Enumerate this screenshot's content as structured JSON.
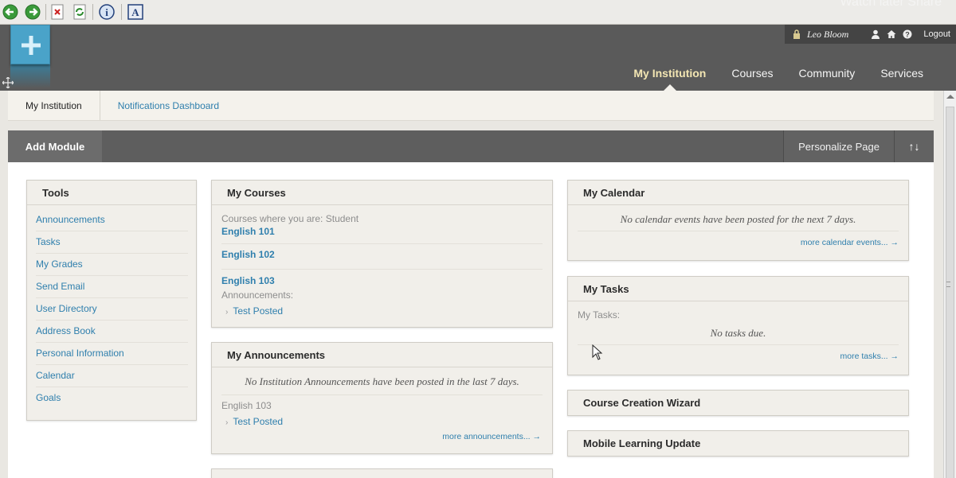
{
  "browser": {
    "overlay_text": "Watch later   Share",
    "buttons": [
      "back-icon",
      "forward-icon",
      "stop-icon",
      "refresh-icon",
      "info-icon",
      "text-icon"
    ]
  },
  "header": {
    "user_name": "Leo Bloom",
    "logout": "Logout",
    "nav": [
      "My Institution",
      "Courses",
      "Community",
      "Services"
    ]
  },
  "subtabs": [
    "My Institution",
    "Notifications Dashboard"
  ],
  "module_bar": {
    "add_module": "Add Module",
    "personalize": "Personalize Page",
    "sort_symbol": "↑↓"
  },
  "tools": {
    "title": "Tools",
    "items": [
      "Announcements",
      "Tasks",
      "My Grades",
      "Send Email",
      "User Directory",
      "Address Book",
      "Personal Information",
      "Calendar",
      "Goals"
    ]
  },
  "my_courses": {
    "title": "My Courses",
    "role_text": "Courses where you are: Student",
    "courses": [
      "English 101",
      "English 102",
      "English 103"
    ],
    "announcements_label": "Announcements:",
    "announcement": "Test Posted"
  },
  "my_announcements": {
    "title": "My Announcements",
    "message": "No Institution Announcements have been posted in the last 7 days.",
    "course": "English 103",
    "announcement": "Test Posted",
    "more": "more announcements... →"
  },
  "my_calendar": {
    "title": "My Calendar",
    "message": "No calendar events have been posted for the next 7 days.",
    "more": "more calendar events... →"
  },
  "my_tasks": {
    "title": "My Tasks",
    "label": "My Tasks:",
    "message": "No tasks due.",
    "more": "more tasks... →"
  },
  "course_wizard": {
    "title": "Course Creation Wizard"
  },
  "mobile_update": {
    "title": "Mobile Learning Update"
  },
  "colors": {
    "header_bg": "#5a5a5a",
    "accent_link": "#2f7fad",
    "active_nav": "#f3e6b3",
    "module_bg": "#f1efea",
    "logo_tile": "#4aa3c9"
  }
}
